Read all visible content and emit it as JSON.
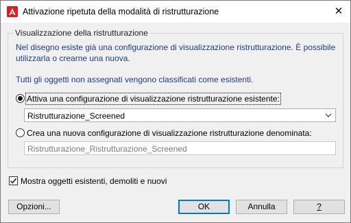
{
  "window": {
    "title": "Attivazione ripetuta della modalità di ristrutturazione",
    "app_icon": "autocad-a-icon",
    "close_label": "✕"
  },
  "group": {
    "legend": "Visualizzazione della ristrutturazione",
    "description": "Nel disegno esiste già una configurazione di visualizzazione ristrutturazione. È possibile utilizzarla o crearne una nuova.",
    "info": "Tutti gli oggetti non assegnati vengono classificati come esistenti.",
    "option_existing": {
      "label": "Attiva una configurazione di visualizzazione ristrutturazione esistente:",
      "selected": true
    },
    "existing_select": {
      "value": "Ristrutturazione_Screened"
    },
    "option_new": {
      "label": "Crea una nuova configurazione di visualizzazione ristrutturazione denominata:",
      "selected": false
    },
    "new_name_field": {
      "value": "Ristrutturazione_Ristrutturazione_Screened"
    }
  },
  "show_objects": {
    "label": "Mostra oggetti esistenti, demoliti e nuovi",
    "checked": true
  },
  "buttons": {
    "options": "Opzioni...",
    "ok": "OK",
    "cancel": "Annulla",
    "help": "?"
  },
  "colors": {
    "accent": "#0078d7",
    "icon_red": "#e21b23",
    "text_blue": "#1e3a8a"
  }
}
